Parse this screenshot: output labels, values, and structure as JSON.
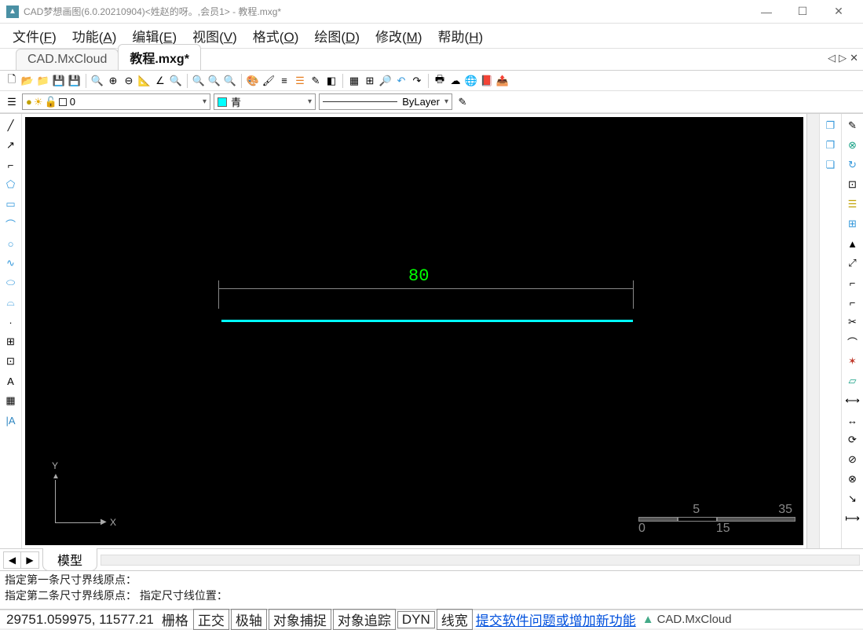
{
  "window": {
    "title": "CAD梦想画图(6.0.20210904)<姓赵的呀。,会员1> - 教程.mxg*"
  },
  "menu": {
    "file": "文件(",
    "file_h": "F",
    "file2": ")",
    "func": "功能(",
    "func_h": "A",
    "func2": ")",
    "edit": "编辑(",
    "edit_h": "E",
    "edit2": ")",
    "view": "视图(",
    "view_h": "V",
    "view2": ")",
    "format": "格式(",
    "format_h": "O",
    "format2": ")",
    "draw": "绘图(",
    "draw_h": "D",
    "draw2": ")",
    "modify": "修改(",
    "modify_h": "M",
    "modify2": ")",
    "help": "帮助(",
    "help_h": "H",
    "help2": ")"
  },
  "tabs": {
    "t1": "CAD.MxCloud",
    "t2": "教程.mxg*"
  },
  "props": {
    "layer_value": "0",
    "color_name": "青",
    "color_hex": "#00ffff",
    "linetype": "ByLayer"
  },
  "canvas": {
    "dimension_text": "80",
    "axis_x": "X",
    "axis_y": "Y",
    "scale_tl": "5",
    "scale_tr": "35",
    "scale_bl": "0",
    "scale_br": "15"
  },
  "model_tab": "模型",
  "cmd": {
    "line1": "指定第一条尺寸界线原点：",
    "line2": "指定第二条尺寸界线原点：  指定尺寸线位置："
  },
  "status": {
    "coord": "29751.059975,  11577.21",
    "grid": "栅格",
    "ortho": "正交",
    "polar": "极轴",
    "osnap": "对象捕捉",
    "otrack": "对象追踪",
    "dyn": "DYN",
    "lw": "线宽",
    "link": "提交软件问题或增加新功能",
    "brand": "CAD.MxCloud"
  }
}
